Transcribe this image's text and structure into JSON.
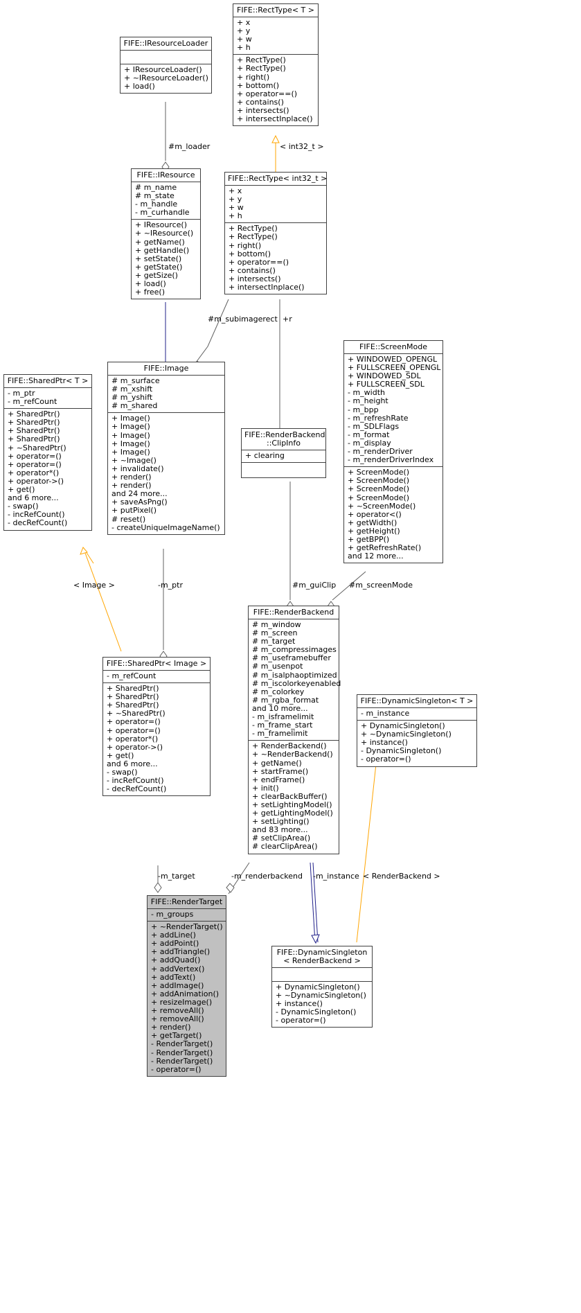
{
  "diagram": {
    "type": "uml-class-diagram",
    "style": "doxygen-collaboration-graph",
    "colors": {
      "box_border": "#404040",
      "box_fill": "#ffffff",
      "highlight_fill": "#c0c0c0",
      "inheritance_edge": "#20208a",
      "usage_edge": "#606060",
      "template_edge": "#ffa500"
    }
  },
  "classes": {
    "rect_type_t": {
      "title": "FIFE::RectType< T >",
      "attributes": [
        "+ x",
        "+ y",
        "+ w",
        "+ h"
      ],
      "operations": [
        "+ RectType()",
        "+ RectType()",
        "+ right()",
        "+ bottom()",
        "+ operator==()",
        "+ contains()",
        "+ intersects()",
        "+ intersectInplace()"
      ]
    },
    "iresource_loader": {
      "title": "FIFE::IResourceLoader",
      "attributes": [],
      "operations": [
        "+ IResourceLoader()",
        "+ ~IResourceLoader()",
        "+ load()"
      ]
    },
    "iresource": {
      "title": "FIFE::IResource",
      "attributes": [
        "# m_name",
        "# m_state",
        "- m_handle",
        "- m_curhandle"
      ],
      "operations": [
        "+ IResource()",
        "+ ~IResource()",
        "+ getName()",
        "+ getHandle()",
        "+ setState()",
        "+ getState()",
        "+ getSize()",
        "+ load()",
        "+ free()"
      ]
    },
    "rect_type_int32": {
      "title": "FIFE::RectType< int32_t >",
      "attributes": [
        "+ x",
        "+ y",
        "+ w",
        "+ h"
      ],
      "operations": [
        "+ RectType()",
        "+ RectType()",
        "+ right()",
        "+ bottom()",
        "+ operator==()",
        "+ contains()",
        "+ intersects()",
        "+ intersectInplace()"
      ]
    },
    "shared_ptr_t": {
      "title": "FIFE::SharedPtr< T >",
      "attributes": [
        "- m_ptr",
        "- m_refCount"
      ],
      "operations": [
        "+ SharedPtr()",
        "+ SharedPtr()",
        "+ SharedPtr()",
        "+ SharedPtr()",
        "+ ~SharedPtr()",
        "+ operator=()",
        "+ operator=()",
        "+ operator*()",
        "+ operator->()",
        "+ get()",
        "and 6 more...",
        "- swap()",
        "- incRefCount()",
        "- decRefCount()"
      ]
    },
    "image": {
      "title": "FIFE::Image",
      "attributes": [
        "# m_surface",
        "# m_xshift",
        "# m_yshift",
        "# m_shared"
      ],
      "operations": [
        "+ Image()",
        "+ Image()",
        "+ Image()",
        "+ Image()",
        "+ Image()",
        "+ ~Image()",
        "+ invalidate()",
        "+ render()",
        "+ render()",
        "and 24 more...",
        "+ saveAsPng()",
        "+ putPixel()",
        "# reset()",
        "- createUniqueImageName()"
      ]
    },
    "clipinfo": {
      "title": "FIFE::RenderBackend\n::ClipInfo",
      "attributes": [
        "+ clearing"
      ],
      "operations": []
    },
    "screenmode": {
      "title": "FIFE::ScreenMode",
      "attributes": [
        "+ WINDOWED_OPENGL",
        "+ FULLSCREEN_OPENGL",
        "+ WINDOWED_SDL",
        "+ FULLSCREEN_SDL",
        "- m_width",
        "- m_height",
        "- m_bpp",
        "- m_refreshRate",
        "- m_SDLFlags",
        "- m_format",
        "- m_display",
        "- m_renderDriver",
        "- m_renderDriverIndex"
      ],
      "operations": [
        "+ ScreenMode()",
        "+ ScreenMode()",
        "+ ScreenMode()",
        "+ ScreenMode()",
        "+ ~ScreenMode()",
        "+ operator<()",
        "+ getWidth()",
        "+ getHeight()",
        "+ getBPP()",
        "+ getRefreshRate()",
        "and 12 more..."
      ]
    },
    "shared_ptr_image": {
      "title": "FIFE::SharedPtr< Image >",
      "attributes": [
        "- m_refCount"
      ],
      "operations": [
        "+ SharedPtr()",
        "+ SharedPtr()",
        "+ SharedPtr()",
        "+ ~SharedPtr()",
        "+ operator=()",
        "+ operator=()",
        "+ operator*()",
        "+ operator->()",
        "+ get()",
        "and 6 more...",
        "- swap()",
        "- incRefCount()",
        "- decRefCount()"
      ]
    },
    "renderbackend": {
      "title": "FIFE::RenderBackend",
      "attributes": [
        "# m_window",
        "# m_screen",
        "# m_target",
        "# m_compressimages",
        "# m_useframebuffer",
        "# m_usenpot",
        "# m_isalphaoptimized",
        "# m_iscolorkeyenabled",
        "# m_colorkey",
        "# m_rgba_format",
        "and 10 more...",
        "- m_isframelimit",
        "- m_frame_start",
        "- m_framelimit"
      ],
      "operations": [
        "+ RenderBackend()",
        "+ ~RenderBackend()",
        "+ getName()",
        "+ startFrame()",
        "+ endFrame()",
        "+ init()",
        "+ clearBackBuffer()",
        "+ setLightingModel()",
        "+ getLightingModel()",
        "+ setLighting()",
        "and 83 more...",
        "# setClipArea()",
        "# clearClipArea()"
      ]
    },
    "dynamic_singleton_t": {
      "title": "FIFE::DynamicSingleton< T >",
      "attributes": [
        "- m_instance"
      ],
      "operations": [
        "+ DynamicSingleton()",
        "+ ~DynamicSingleton()",
        "+ instance()",
        "- DynamicSingleton()",
        "- operator=()"
      ]
    },
    "rendertarget": {
      "title": "FIFE::RenderTarget",
      "attributes": [
        "- m_groups"
      ],
      "operations": [
        "+ ~RenderTarget()",
        "+ addLine()",
        "+ addPoint()",
        "+ addTriangle()",
        "+ addQuad()",
        "+ addVertex()",
        "+ addText()",
        "+ addImage()",
        "+ addAnimation()",
        "+ resizeImage()",
        "+ removeAll()",
        "+ removeAll()",
        "+ render()",
        "+ getTarget()",
        "- RenderTarget()",
        "- RenderTarget()",
        "- RenderTarget()",
        "- operator=()"
      ],
      "highlighted": true
    },
    "dynamic_singleton_rb": {
      "title": "FIFE::DynamicSingleton\n< RenderBackend >",
      "attributes": [],
      "operations": [
        "+ DynamicSingleton()",
        "+ ~DynamicSingleton()",
        "+ instance()",
        "- DynamicSingleton()",
        "- operator=()"
      ]
    }
  },
  "edge_labels": {
    "m_loader": "#m_loader",
    "int32_t": "< int32_t >",
    "m_subimagerect": "#m_subimagerect",
    "r": "+r",
    "image_tmpl": "< Image >",
    "m_ptr": "-m_ptr",
    "m_guiClip": "#m_guiClip",
    "m_screenMode": "#m_screenMode",
    "m_target": "-m_target",
    "m_renderbackend": "-m_renderbackend",
    "m_instance": "-m_instance",
    "renderbackend_tmpl": "< RenderBackend >"
  }
}
